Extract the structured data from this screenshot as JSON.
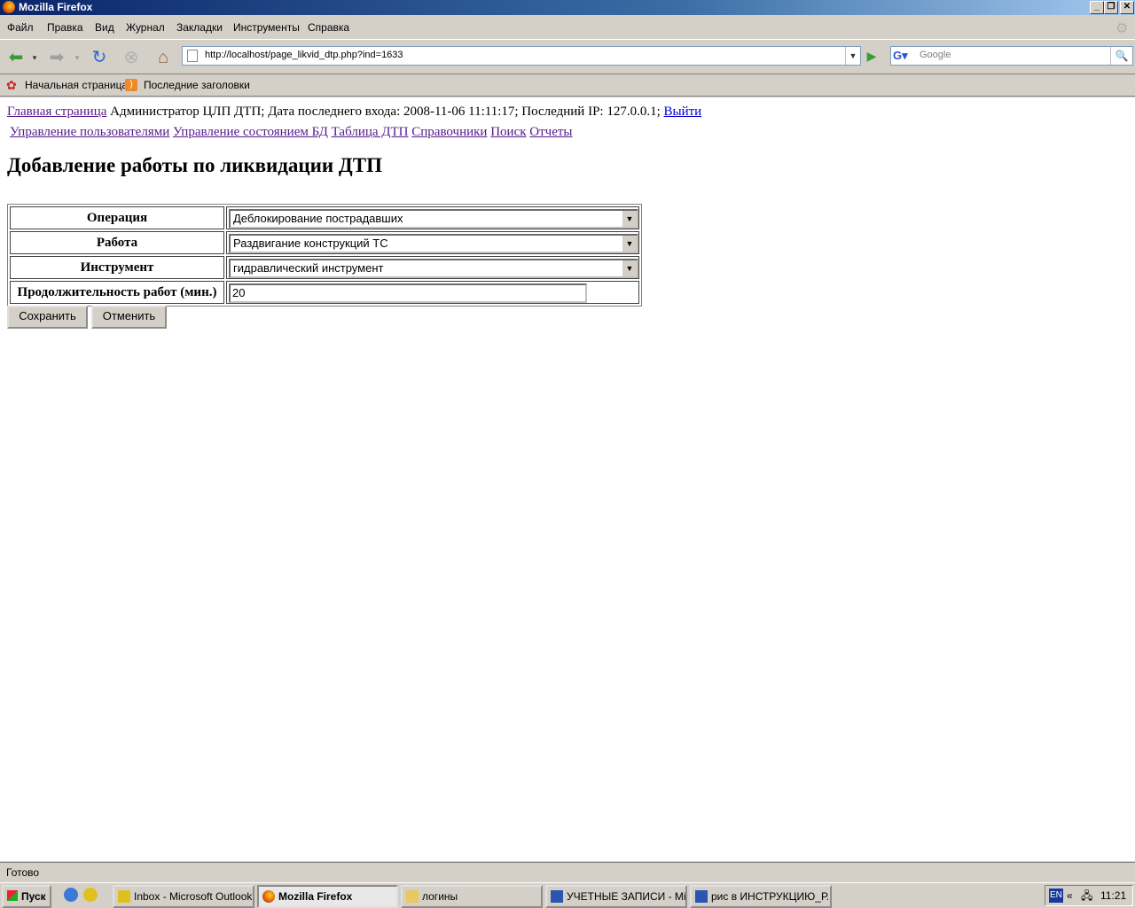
{
  "window": {
    "title": "Mozilla Firefox"
  },
  "menu": [
    "Файл",
    "Правка",
    "Вид",
    "Журнал",
    "Закладки",
    "Инструменты",
    "Справка"
  ],
  "navbar": {
    "url": "http://localhost/page_likvid_dtp.php?ind=1633",
    "search_placeholder": "Google"
  },
  "bookmarks": [
    "Начальная страница",
    "Последние заголовки"
  ],
  "page": {
    "home_link": "Главная страница",
    "user_info": " Администратор ЦЛП ДТП; Дата последнего входа: 2008-11-06 11:11:17; Последний IP: 127.0.0.1; ",
    "logout_link": "Выйти",
    "nav_links": [
      "Управление пользователями",
      "Управление состоянием БД",
      "Таблица ДТП",
      "Справочники",
      "Поиск",
      "Отчеты"
    ],
    "heading": "Добавление работы по ликвидации ДТП",
    "form": {
      "operation_label": "Операция",
      "operation_value": "Деблокирование пострадавших",
      "work_label": "Работа",
      "work_value": "Раздвигание конструкций ТС",
      "tool_label": "Инструмент",
      "tool_value": "гидравлический инструмент",
      "duration_label": "Продолжительность работ (мин.)",
      "duration_value": "20"
    },
    "save_label": "Сохранить",
    "cancel_label": "Отменить"
  },
  "status": "Готово",
  "taskbar": {
    "start": "Пуск",
    "tasks": [
      "Inbox - Microsoft Outlook",
      "Mozilla Firefox",
      "логины",
      "УЧЕТНЫЕ ЗАПИСИ - Mi...",
      "рис в ИНСТРУКЦИЮ_Р..."
    ],
    "lang": "EN",
    "time": "11:21"
  }
}
